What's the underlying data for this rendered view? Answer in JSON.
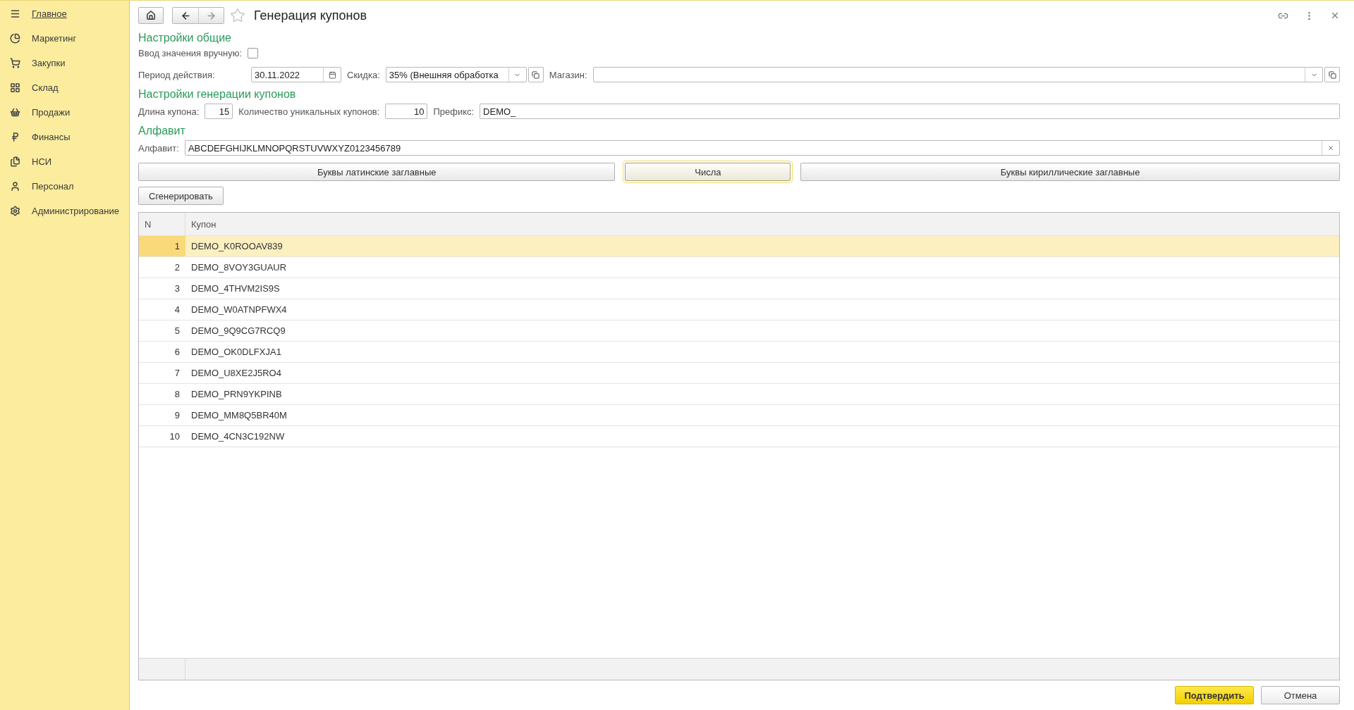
{
  "sidebar": {
    "items": [
      {
        "label": "Главное",
        "selected": true
      },
      {
        "label": "Маркетинг",
        "selected": false
      },
      {
        "label": "Закупки",
        "selected": false
      },
      {
        "label": "Склад",
        "selected": false
      },
      {
        "label": "Продажи",
        "selected": false
      },
      {
        "label": "Финансы",
        "selected": false
      },
      {
        "label": "НСИ",
        "selected": false
      },
      {
        "label": "Персонал",
        "selected": false
      },
      {
        "label": "Администрирование",
        "selected": false
      }
    ]
  },
  "window": {
    "title": "Генерация купонов"
  },
  "general": {
    "title": "Настройки общие",
    "manual_label": "Ввод значения вручную:",
    "manual_checked": false,
    "period_label": "Период действия:",
    "period_value": "30.11.2022",
    "discount_label": "Скидка:",
    "discount_value": "35% (Внешняя обработка",
    "shop_label": "Магазин:"
  },
  "generation": {
    "title": "Настройки генерации купонов",
    "length_label": "Длина купона:",
    "length_value": "15",
    "count_label": "Количество уникальных купонов:",
    "count_value": "10",
    "prefix_label": "Префикс:",
    "prefix_value": "DEMO_"
  },
  "alphabet": {
    "title": "Алфавит",
    "label": "Алфавит:",
    "value": "ABCDEFGHIJKLMNOPQRSTUVWXYZ0123456789",
    "buttons": [
      {
        "label": "Буквы латинские заглавные",
        "selected": false
      },
      {
        "label": "Числа",
        "selected": true
      },
      {
        "label": "Буквы кириллические заглавные",
        "selected": false
      }
    ]
  },
  "generate_button": "Сгенерировать",
  "table": {
    "columns": [
      "N",
      "Купон"
    ],
    "rows": [
      {
        "n": "1",
        "coupon": "DEMO_K0ROOAV839",
        "selected": true
      },
      {
        "n": "2",
        "coupon": "DEMO_8VOY3GUAUR",
        "selected": false
      },
      {
        "n": "3",
        "coupon": "DEMO_4THVM2IS9S",
        "selected": false
      },
      {
        "n": "4",
        "coupon": "DEMO_W0ATNPFWX4",
        "selected": false
      },
      {
        "n": "5",
        "coupon": "DEMO_9Q9CG7RCQ9",
        "selected": false
      },
      {
        "n": "6",
        "coupon": "DEMO_OK0DLFXJA1",
        "selected": false
      },
      {
        "n": "7",
        "coupon": "DEMO_U8XE2J5RO4",
        "selected": false
      },
      {
        "n": "8",
        "coupon": "DEMO_PRN9YKPINB",
        "selected": false
      },
      {
        "n": "9",
        "coupon": "DEMO_MM8Q5BR40M",
        "selected": false
      },
      {
        "n": "10",
        "coupon": "DEMO_4CN3C192NW",
        "selected": false
      }
    ]
  },
  "footer_buttons": [
    {
      "label": "Подтвердить",
      "kind": "primary"
    },
    {
      "label": "Отмена",
      "kind": "secondary"
    }
  ]
}
